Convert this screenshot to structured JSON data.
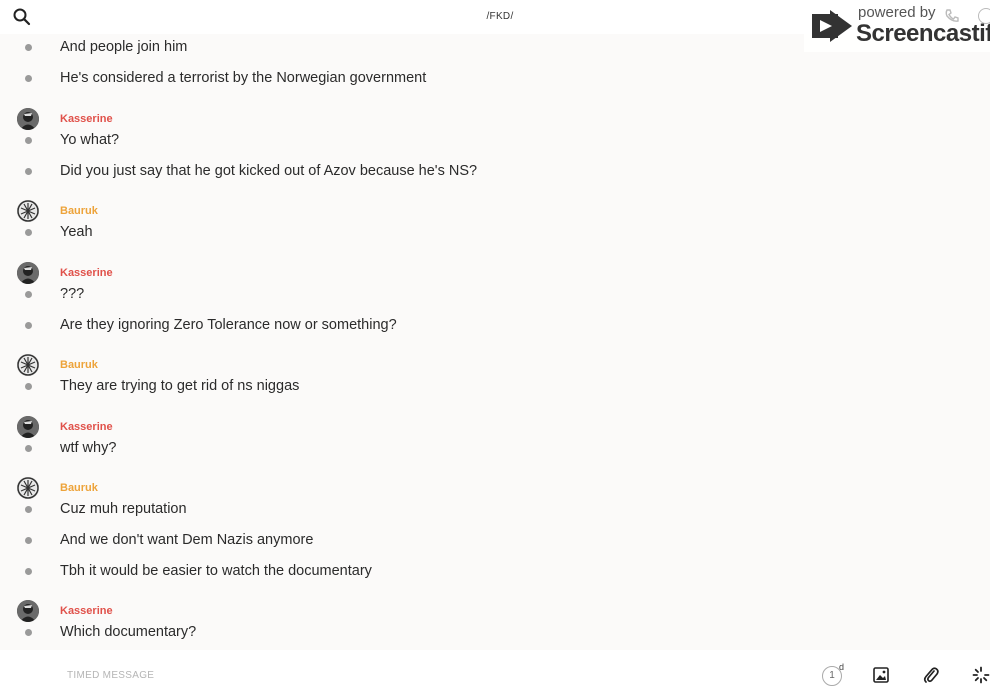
{
  "header": {
    "title": "/FKD/",
    "search_icon": "search-icon"
  },
  "watermark": {
    "small": "powered by",
    "big": "Screencastify"
  },
  "colors": {
    "kasserine": "#e0514a",
    "bauruk": "#eda33a",
    "bullet": "#9a9a9a"
  },
  "messages": [
    {
      "text": "And people join him"
    },
    {
      "text": "He's considered a terrorist by the Norwegian government"
    },
    {
      "sender": "Kasserine",
      "text": "Yo what?"
    },
    {
      "text": "Did you just say that he got kicked out of Azov because he's NS?"
    },
    {
      "sender": "Bauruk",
      "text": "Yeah"
    },
    {
      "sender": "Kasserine",
      "text": "???"
    },
    {
      "text": "Are they ignoring Zero Tolerance now or something?"
    },
    {
      "sender": "Bauruk",
      "text": "They are trying to get rid of ns niggas"
    },
    {
      "sender": "Kasserine",
      "text": "wtf why?"
    },
    {
      "sender": "Bauruk",
      "text": "Cuz muh reputation"
    },
    {
      "text": "And we don't want Dem Nazis anymore"
    },
    {
      "text": "Tbh it would be easier to watch the documentary"
    },
    {
      "sender": "Kasserine",
      "text": "Which documentary?"
    }
  ],
  "composer": {
    "placeholder": "TIMED MESSAGE",
    "timer_value": "1",
    "timer_unit": "d"
  }
}
